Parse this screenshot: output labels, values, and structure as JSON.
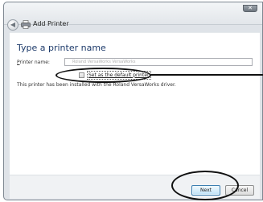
{
  "window": {
    "title": "Add Printer",
    "close_glyph": "✕",
    "back_glyph": "◀",
    "back_icon": "back-arrow-icon",
    "printer_icon": "printer-icon"
  },
  "page": {
    "heading": "Type a printer name",
    "printer_name_label_prefix": "",
    "printer_name_label_underline": "P",
    "printer_name_label_rest": "rinter name:",
    "printer_name_value": "Roland VersaWorks VersaWorks",
    "set_default_label": "Set as the default printer",
    "set_default_checked": false,
    "installed_note": "This printer has been installed with the Roland VersaWorks driver."
  },
  "footer": {
    "next_label": "Next",
    "cancel_label": "Cancel"
  },
  "colors": {
    "heading": "#1e3b6b",
    "window_frame": "#dfe3e8",
    "next_button_border": "#3c7fb1"
  }
}
